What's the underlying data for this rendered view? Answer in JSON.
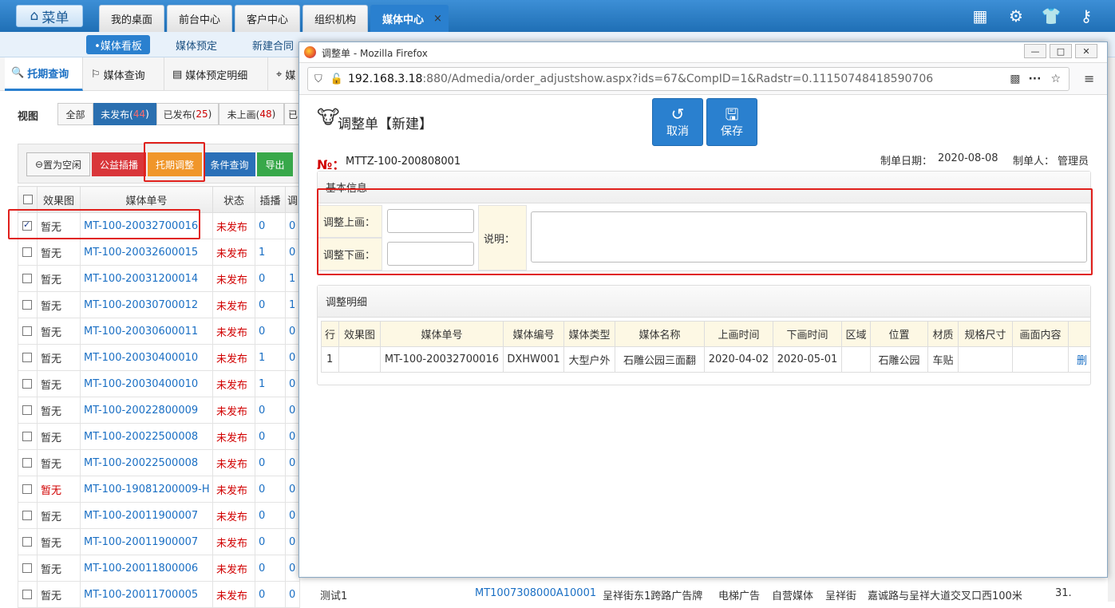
{
  "top": {
    "menu_label": "菜单",
    "tabs": [
      "我的桌面",
      "前台中心",
      "客户中心",
      "组织机构",
      "媒体中心"
    ],
    "active_tab_close": "×",
    "icons": [
      "grid-icon",
      "gear-icon",
      "shirt-icon",
      "key-icon",
      "power-icon"
    ]
  },
  "subnav": {
    "items": [
      "•媒体看板",
      "媒体预定",
      "新建合同"
    ]
  },
  "thirdnav": {
    "items": [
      "托期查询",
      "媒体查询",
      "媒体预定明细",
      "媒"
    ]
  },
  "view": {
    "label": "视图",
    "all": "全部",
    "filters": [
      {
        "label": "未发布(",
        "count": "44",
        "close": ")"
      },
      {
        "label": "已发布(",
        "count": "25",
        "close": ")"
      },
      {
        "label": "未上画(",
        "count": "48",
        "close": ")"
      },
      {
        "label": "已",
        "count": "",
        "close": ""
      }
    ]
  },
  "actions": {
    "set_idle": "置为空闲",
    "public_insert": "公益插播",
    "delay_adjust": "托期调整",
    "condition_query": "条件查询",
    "export": "导出"
  },
  "grid": {
    "headers": [
      "效果图",
      "媒体单号",
      "状态",
      "插播",
      "调"
    ],
    "rows": [
      {
        "img": "暂无",
        "no": "MT-100-20032700016",
        "status": "未发布",
        "ins": "0",
        "adj": "0",
        "checked": true,
        "img_red": false,
        "status_red": true
      },
      {
        "img": "暂无",
        "no": "MT-100-20032600015",
        "status": "未发布",
        "ins": "1",
        "adj": "0",
        "checked": false,
        "img_red": false,
        "status_red": true
      },
      {
        "img": "暂无",
        "no": "MT-100-20031200014",
        "status": "未发布",
        "ins": "0",
        "adj": "1",
        "checked": false,
        "img_red": false,
        "status_red": true
      },
      {
        "img": "暂无",
        "no": "MT-100-20030700012",
        "status": "未发布",
        "ins": "0",
        "adj": "1",
        "checked": false,
        "img_red": false,
        "status_red": true
      },
      {
        "img": "暂无",
        "no": "MT-100-20030600011",
        "status": "未发布",
        "ins": "0",
        "adj": "0",
        "checked": false,
        "img_red": false,
        "status_red": true
      },
      {
        "img": "暂无",
        "no": "MT-100-20030400010",
        "status": "未发布",
        "ins": "1",
        "adj": "0",
        "checked": false,
        "img_red": false,
        "status_red": true
      },
      {
        "img": "暂无",
        "no": "MT-100-20030400010",
        "status": "未发布",
        "ins": "1",
        "adj": "0",
        "checked": false,
        "img_red": false,
        "status_red": true
      },
      {
        "img": "暂无",
        "no": "MT-100-20022800009",
        "status": "未发布",
        "ins": "0",
        "adj": "0",
        "checked": false,
        "img_red": false,
        "status_red": true
      },
      {
        "img": "暂无",
        "no": "MT-100-20022500008",
        "status": "未发布",
        "ins": "0",
        "adj": "0",
        "checked": false,
        "img_red": false,
        "status_red": true
      },
      {
        "img": "暂无",
        "no": "MT-100-20022500008",
        "status": "未发布",
        "ins": "0",
        "adj": "0",
        "checked": false,
        "img_red": false,
        "status_red": true
      },
      {
        "img": "暂无",
        "no": "MT-100-19081200009-H",
        "status": "未发布",
        "ins": "0",
        "adj": "0",
        "checked": false,
        "img_red": true,
        "status_red": true
      },
      {
        "img": "暂无",
        "no": "MT-100-20011900007",
        "status": "未发布",
        "ins": "0",
        "adj": "0",
        "checked": false,
        "img_red": false,
        "status_red": true
      },
      {
        "img": "暂无",
        "no": "MT-100-20011900007",
        "status": "未发布",
        "ins": "0",
        "adj": "0",
        "checked": false,
        "img_red": false,
        "status_red": true
      },
      {
        "img": "暂无",
        "no": "MT-100-20011800006",
        "status": "未发布",
        "ins": "0",
        "adj": "0",
        "checked": false,
        "img_red": false,
        "status_red": true
      },
      {
        "img": "暂无",
        "no": "MT-100-20011700005",
        "status": "未发布",
        "ins": "0",
        "adj": "0",
        "checked": false,
        "img_red": false,
        "status_red": true
      }
    ],
    "last_row_extra": {
      "c1": "测试1",
      "c2": "MT1007308000A10001",
      "c3": "呈祥街东1跨路广告牌",
      "c4": "电梯广告",
      "c5": "自营媒体",
      "c6": "呈祥街",
      "c7": "嘉诚路与呈祥大道交叉口西100米",
      "c8": "31."
    }
  },
  "firefox": {
    "title": "调整单 - Mozilla Firefox",
    "url_host": "192.168.3.18",
    "url_rest": ":880/Admedia/order_adjustshow.aspx?ids=67&CompID=1&Radstr=0.11150748418590706",
    "controls": [
      "—",
      "□",
      "✕"
    ]
  },
  "dialog": {
    "title": "调整单【新建】",
    "cancel": "取消",
    "save": "保存",
    "no_label": "№：",
    "no_value": "MTTZ-100-200808001",
    "date_label": "制单日期：",
    "date_value": "2020-08-08",
    "maker_label": "制单人：",
    "maker_value": "管理员",
    "basic_title": "基本信息",
    "adj_up": "调整上画：",
    "adj_down": "调整下画：",
    "note": "说明：",
    "detail_title": "调整明细",
    "detail_headers": [
      "行",
      "效果图",
      "媒体单号",
      "媒体编号",
      "媒体类型",
      "媒体名称",
      "上画时间",
      "下画时间",
      "区域",
      "位置",
      "材质",
      "规格尺寸",
      "画面内容",
      ""
    ],
    "detail_rows": [
      [
        "1",
        "",
        "MT-100-20032700016",
        "DXHW001",
        "大型户外",
        "石雕公园三面翻",
        "2020-04-02",
        "2020-05-01",
        "",
        "石雕公园",
        "车贴",
        "",
        "",
        "删"
      ]
    ]
  },
  "colors": {
    "accent": "#2a80cf",
    "highlight": "#e0201c",
    "status_red": "#d10000",
    "link": "#1a6fc4"
  }
}
